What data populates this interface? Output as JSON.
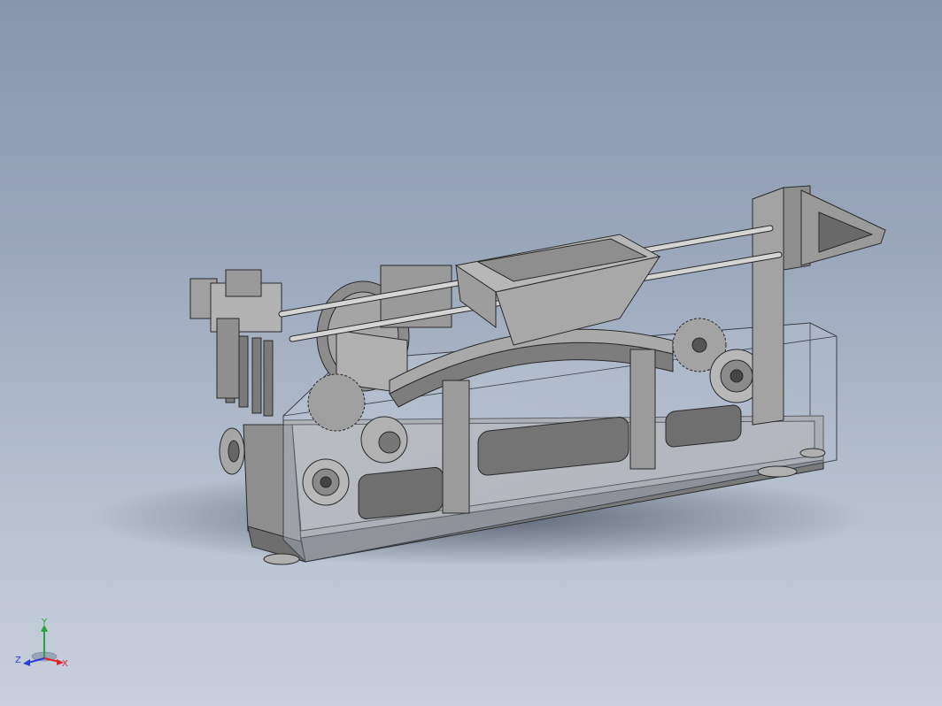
{
  "colors": {
    "background_top": "#8796ad",
    "background_bottom": "#c9d0dc",
    "metal": "#9c9c9c",
    "metal_dark": "#5f5f5f",
    "metal_light": "#cfcfcf",
    "edge": "#2a2a2a",
    "glass": "#b8c4d6",
    "axis_x": "#e0242a",
    "axis_y": "#22a83a",
    "axis_z": "#2a3fd6"
  },
  "triad": {
    "x_label": "X",
    "y_label": "Y",
    "z_label": "Z"
  }
}
